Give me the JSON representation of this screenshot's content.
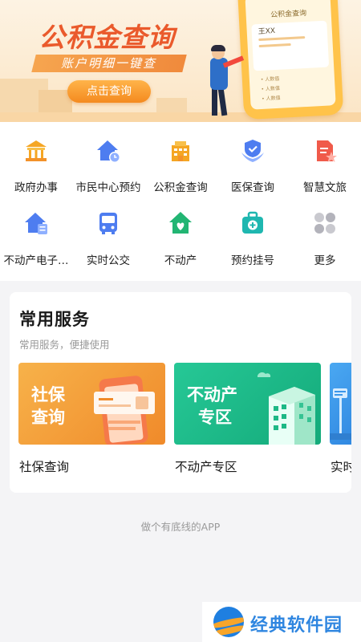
{
  "banner": {
    "title": "公积金查询",
    "subtitle": "账户明细一键查",
    "button_label": "点击查询",
    "phone_title": "公积金查询",
    "phone_name": "王XX",
    "phone_rows": [
      "• 人数值",
      "• 人数值",
      "• 人数值"
    ]
  },
  "grid": {
    "items": [
      {
        "label": "政府办事",
        "icon": "government-building-icon"
      },
      {
        "label": "市民中心预约",
        "icon": "home-clock-icon"
      },
      {
        "label": "公积金查询",
        "icon": "fund-building-icon"
      },
      {
        "label": "医保查询",
        "icon": "shield-hands-icon"
      },
      {
        "label": "智慧文旅",
        "icon": "document-star-icon"
      },
      {
        "label": "不动产电子…",
        "icon": "home-document-icon"
      },
      {
        "label": "实时公交",
        "icon": "bus-icon"
      },
      {
        "label": "不动产",
        "icon": "home-heart-icon"
      },
      {
        "label": "预约挂号",
        "icon": "medical-kit-icon"
      },
      {
        "label": "更多",
        "icon": "more-grid-icon"
      }
    ]
  },
  "common_services": {
    "title": "常用服务",
    "subtitle": "常用服务，便捷使用",
    "items": [
      {
        "label": "社保查询",
        "image_text": [
          "社保",
          "查询"
        ],
        "color": "#f29a3a"
      },
      {
        "label": "不动产专区",
        "image_text": [
          "不动产",
          "专区"
        ],
        "color": "#1db886"
      },
      {
        "label": "实时",
        "image_text": [],
        "color": "#3a96ea"
      }
    ]
  },
  "footer_text": "做个有底线的APP",
  "watermark": {
    "text": "经典软件园"
  },
  "colors": {
    "accent": "#f08a2a",
    "brand_blue": "#2f86e0",
    "green": "#1db886"
  }
}
